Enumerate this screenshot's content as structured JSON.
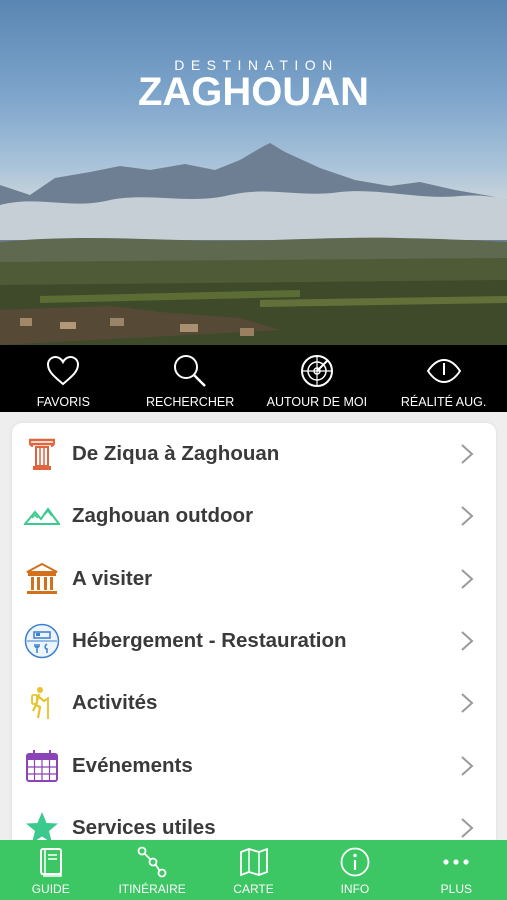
{
  "brand": {
    "top": "DESTINATION",
    "main": "ZAGHOUAN"
  },
  "topbar": [
    {
      "label": "FAVORIS",
      "icon": "heart-icon"
    },
    {
      "label": "RECHERCHER",
      "icon": "search-icon"
    },
    {
      "label": "AUTOUR DE MOI",
      "icon": "radar-icon"
    },
    {
      "label": "RÉALITÉ AUG.",
      "icon": "eye-icon"
    }
  ],
  "menu": [
    {
      "label": "De Ziqua à Zaghouan",
      "icon": "column-icon",
      "color": "#e0643c"
    },
    {
      "label": "Zaghouan outdoor",
      "icon": "mountains-icon",
      "color": "#3cc98e"
    },
    {
      "label": "A visiter",
      "icon": "monument-icon",
      "color": "#d2701c"
    },
    {
      "label": "Hébergement - Restauration",
      "icon": "bed-fork-icon",
      "color": "#3a7fd0"
    },
    {
      "label": "Activités",
      "icon": "hiker-icon",
      "color": "#e8c12c"
    },
    {
      "label": "Evénements",
      "icon": "calendar-icon",
      "color": "#8b44b8"
    },
    {
      "label": "Services utiles",
      "icon": "star-icon",
      "color": "#3cc98e"
    }
  ],
  "tabbar": [
    {
      "label": "GUIDE",
      "icon": "book-icon"
    },
    {
      "label": "ITINÉRAIRE",
      "icon": "route-icon"
    },
    {
      "label": "CARTE",
      "icon": "map-icon"
    },
    {
      "label": "INFO",
      "icon": "info-icon"
    },
    {
      "label": "PLUS",
      "icon": "more-icon"
    }
  ]
}
